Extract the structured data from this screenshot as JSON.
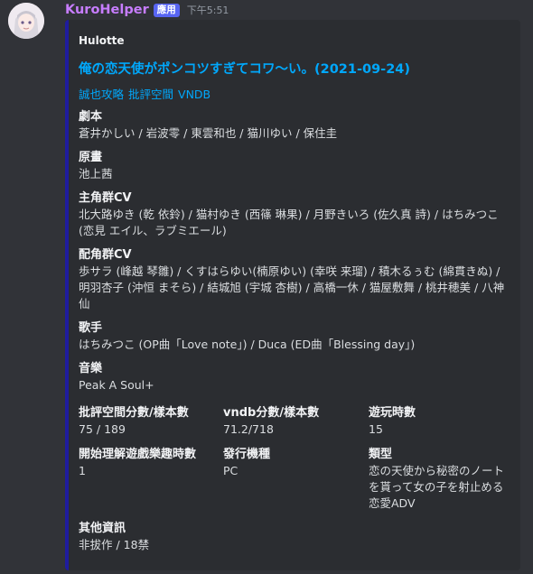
{
  "message": {
    "author": "KuroHelper",
    "app_tag": "應用",
    "timestamp": "下午5:51"
  },
  "embed": {
    "accent_color": "#1f1c9e",
    "author": "Hulotte",
    "title": "俺の恋天使がポンコツすぎてコワ～い。(2021-09-24)",
    "links": [
      "誠也攻略",
      "批評空間",
      "VNDB"
    ],
    "fields": [
      {
        "name": "劇本",
        "value": "蒼井かしい / 岩波零 / 東雲和也 / 猫川ゆい / 保住圭"
      },
      {
        "name": "原畫",
        "value": "池上茜"
      },
      {
        "name": "主角群CV",
        "value": "北大路ゆき (乾 依鈴) / 猫村ゆき (西篠 琳果) / 月野きいろ (佐久真 詩) / はちみつこ (恋見 エイル、ラブミエール)"
      },
      {
        "name": "配角群CV",
        "value": "歩サラ (峰越 琴雛) / くすはらゆい(楠原ゆい) (幸咲 来瑠) / 積木るぅむ (綿貫きぬ) / 明羽杏子 (沖恒 まそら) / 結城旭 (宇城 杏樹) / 高橋一休 / 猫屋敷舞 / 桃井穂美 / 八神仙"
      },
      {
        "name": "歌手",
        "value": "はちみつこ (OP曲「Love note」) / Duca (ED曲「Blessing day」)"
      },
      {
        "name": "音樂",
        "value": "Peak A Soul+"
      }
    ],
    "inline_fields_row1": [
      {
        "name": "批評空間分數/樣本數",
        "value": "75 / 189"
      },
      {
        "name": "vndb分數/樣本數",
        "value": "71.2/718"
      },
      {
        "name": "遊玩時數",
        "value": "15"
      }
    ],
    "inline_fields_row2": [
      {
        "name": "開始理解遊戲樂趣時數",
        "value": "1"
      },
      {
        "name": "發行機種",
        "value": "PC"
      },
      {
        "name": "類型",
        "value": "恋の天使から秘密のノートを貰って女の子を射止める恋愛ADV"
      }
    ],
    "last_field": {
      "name": "其他資訊",
      "value": "非拔作 / 18禁"
    }
  }
}
